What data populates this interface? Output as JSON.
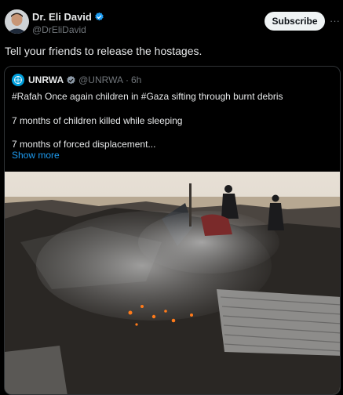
{
  "tweet": {
    "author_name": "Dr. Eli David",
    "author_handle": "@DrEliDavid",
    "subscribe_label": "Subscribe",
    "more_icon": "more-dots-icon",
    "text": "Tell your friends to release the hostages."
  },
  "quoted": {
    "name": "UNRWA",
    "handle": "@UNRWA",
    "separator": "·",
    "time": "6h",
    "lines": [
      "#Rafah Once again children in #Gaza sifting through burnt debris",
      "7 months of children killed while sleeping",
      "7 months of forced displacement..."
    ],
    "show_more": "Show more",
    "image_icon": "photo"
  },
  "colors": {
    "background": "#000000",
    "text": "#e7e9ea",
    "muted": "#71767b",
    "link": "#1d9bf0",
    "verified": "#1d9bf0",
    "subscribe_bg": "#eff3f4",
    "border": "#2f3336",
    "unrwa_blue": "#009edb"
  }
}
